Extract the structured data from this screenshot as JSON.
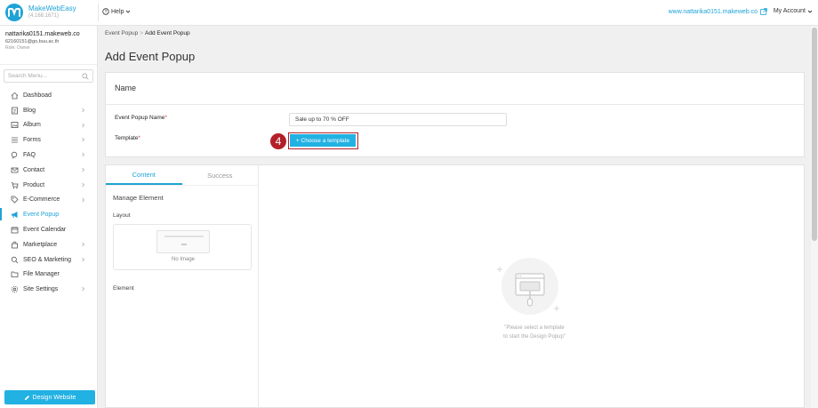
{
  "brand": {
    "name": "MakeWebEasy",
    "version": "(4.168.1671)"
  },
  "topbar": {
    "help_label": "Help",
    "site_link": "www.nattarika0151.makeweb.co",
    "account_label": "My Account"
  },
  "user": {
    "site": "nattarika0151.makeweb.co",
    "email": "62160151@go.buu.ac.th",
    "role": "Role: Owner"
  },
  "search": {
    "placeholder": "Search Menu..."
  },
  "menu": [
    {
      "label": "Dashboad",
      "icon": "home-icon",
      "chevron": false,
      "active": false
    },
    {
      "label": "Blog",
      "icon": "document-icon",
      "chevron": true,
      "active": false
    },
    {
      "label": "Album",
      "icon": "image-icon",
      "chevron": true,
      "active": false
    },
    {
      "label": "Forms",
      "icon": "list-icon",
      "chevron": true,
      "active": false
    },
    {
      "label": "FAQ",
      "icon": "chat-icon",
      "chevron": true,
      "active": false
    },
    {
      "label": "Contact",
      "icon": "mail-icon",
      "chevron": true,
      "active": false
    },
    {
      "label": "Product",
      "icon": "cart-icon",
      "chevron": true,
      "active": false
    },
    {
      "label": "E-Commerce",
      "icon": "tag-icon",
      "chevron": true,
      "active": false
    },
    {
      "label": "Event Popup",
      "icon": "megaphone-icon",
      "chevron": false,
      "active": true
    },
    {
      "label": "Event Calendar",
      "icon": "calendar-icon",
      "chevron": false,
      "active": false
    },
    {
      "label": "Marketplace",
      "icon": "bag-icon",
      "chevron": true,
      "active": false
    },
    {
      "label": "SEO & Marketing",
      "icon": "search-icon",
      "chevron": true,
      "active": false
    },
    {
      "label": "File Manager",
      "icon": "folder-icon",
      "chevron": false,
      "active": false
    },
    {
      "label": "Site Settings",
      "icon": "gear-icon",
      "chevron": true,
      "active": false
    }
  ],
  "design_button": "Design Website",
  "breadcrumb": {
    "parent": "Event Popup",
    "current": "Add Event Popup"
  },
  "page_title": "Add Event Popup",
  "name_card": {
    "heading": "Name",
    "popup_name_label": "Event Popup Name",
    "popup_name_value": "Sale up to 70 % OFF",
    "template_label": "Template",
    "template_button": "+ Choose a template",
    "step_number": "4"
  },
  "design": {
    "tabs": [
      "Content",
      "Success"
    ],
    "active_tab": 0,
    "manage_title": "Manage Element",
    "layout_label": "Layout",
    "no_image": "No Image",
    "element_label": "Element",
    "empty_line1": "\"Please select a template",
    "empty_line2": "to start the Design Popup\""
  },
  "colors": {
    "accent": "#22b1e3",
    "highlight": "#b3202a"
  }
}
